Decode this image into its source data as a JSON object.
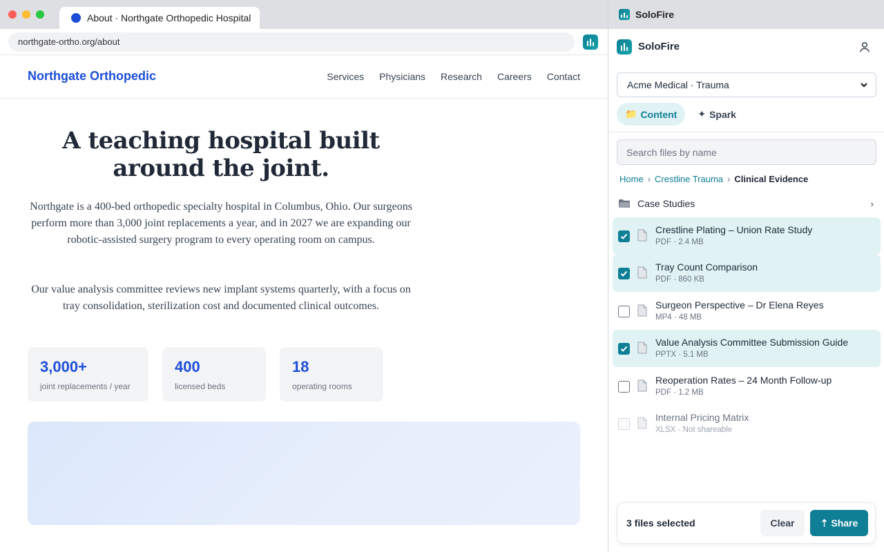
{
  "browser": {
    "tab_title": "About · Northgate Orthopedic Hospital",
    "url": "northgate-ortho.org/about"
  },
  "site": {
    "brand": "Northgate Orthopedic",
    "nav": [
      "Services",
      "Physicians",
      "Research",
      "Careers",
      "Contact"
    ],
    "hero_title": "A teaching hospital built around the joint.",
    "paragraph1": "Northgate is a 400-bed orthopedic specialty hospital in Columbus, Ohio. Our surgeons perform more than 3,000 joint replacements a year, and in 2027 we are expanding our robotic-assisted surgery program to every operating room on campus.",
    "paragraph2": "Our value analysis committee reviews new implant systems quarterly, with a focus on tray consolidation, sterilization cost and documented clinical outcomes.",
    "stats": [
      {
        "value": "3,000+",
        "label": "joint replacements / year"
      },
      {
        "value": "400",
        "label": "licensed beds"
      },
      {
        "value": "18",
        "label": "operating rooms"
      }
    ]
  },
  "panel": {
    "window_title": "SoloFire",
    "app_name": "SoloFire",
    "org_selected": "Acme Medical · Trauma",
    "tabs": [
      {
        "glyph": "📁",
        "label": "Content"
      },
      {
        "glyph": "✦",
        "label": "Spark"
      }
    ],
    "search_placeholder": "Search files by name",
    "breadcrumb": [
      "Home",
      "Crestline Trauma",
      "Clinical Evidence"
    ],
    "breadcrumb_sep": "›",
    "folder": {
      "name": "Case Studies",
      "chevron": "›"
    },
    "files": [
      {
        "name": "Crestline Plating – Union Rate Study",
        "meta": "PDF · 2.4 MB",
        "selected": true,
        "disabled": false
      },
      {
        "name": "Tray Count Comparison",
        "meta": "PDF · 860 KB",
        "selected": true,
        "disabled": false
      },
      {
        "name": "Surgeon Perspective – Dr Elena Reyes",
        "meta": "MP4 · 48 MB",
        "selected": false,
        "disabled": false
      },
      {
        "name": "Value Analysis Committee Submission Guide",
        "meta": "PPTX · 5.1 MB",
        "selected": true,
        "disabled": false
      },
      {
        "name": "Reoperation Rates – 24 Month Follow-up",
        "meta": "PDF · 1.2 MB",
        "selected": false,
        "disabled": false
      },
      {
        "name": "Internal Pricing Matrix",
        "meta": "XLSX · Not shareable",
        "selected": false,
        "disabled": true
      }
    ],
    "selection_text": "3 files selected",
    "clear_label": "Clear",
    "share_label": "⇡ Share"
  },
  "colors": {
    "site_accent": "#1d4ed8",
    "panel_accent": "#0e7f95",
    "selected_row": "#e0f2f4"
  }
}
